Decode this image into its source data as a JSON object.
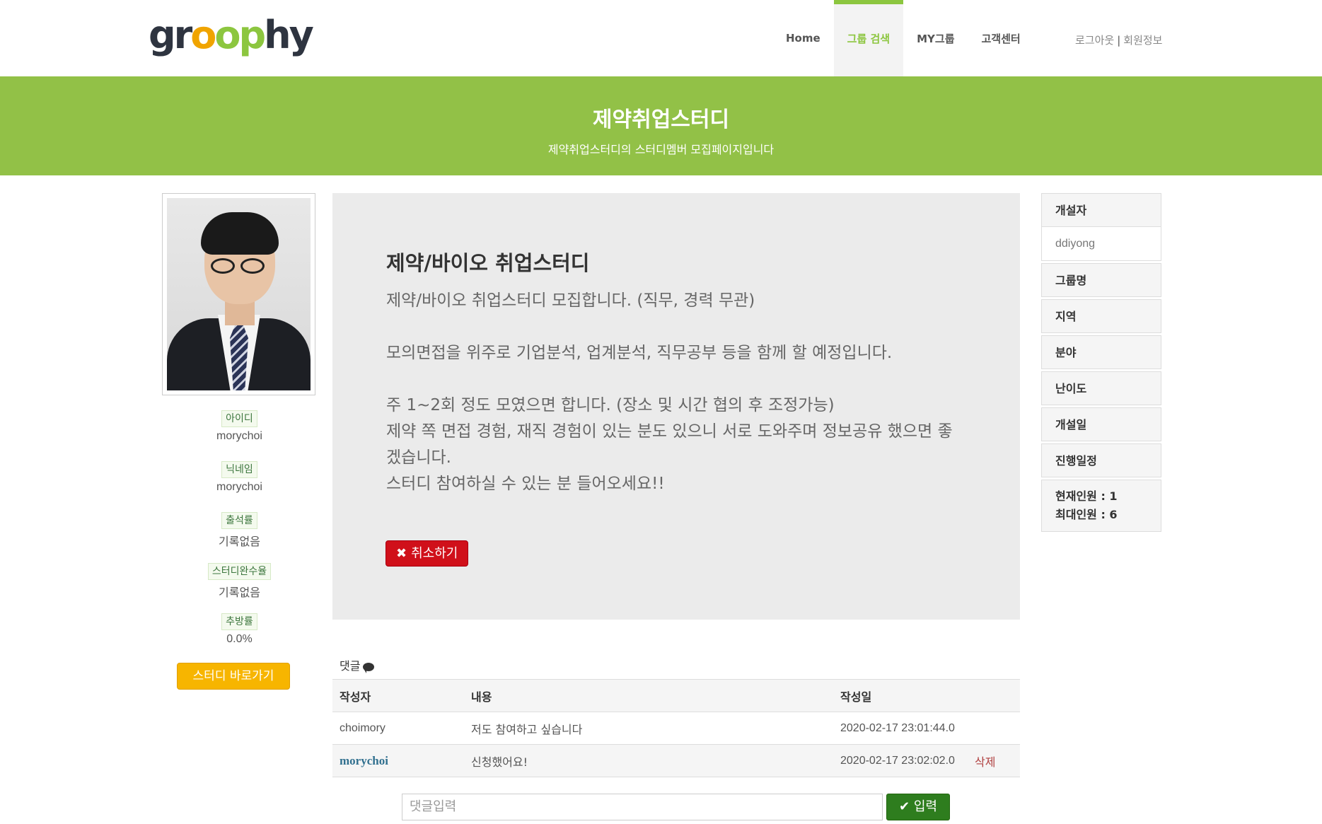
{
  "header": {
    "logo": "groophy",
    "nav": [
      "Home",
      "그룹 검색",
      "MY그룹",
      "고객센터"
    ],
    "active_nav": "그룹 검색",
    "logout": "로그아웃",
    "separator": "|",
    "member_info": "회원정보"
  },
  "banner": {
    "title": "제약취업스터디",
    "subtitle": "제약취업스터디의 스터디멤버 모집페이지입니다"
  },
  "profile": {
    "fields": [
      {
        "label": "아이디",
        "value": "morychoi"
      },
      {
        "label": "닉네임",
        "value": "morychoi"
      },
      {
        "label": "출석률",
        "value": "기록없음"
      },
      {
        "label": "스터디완수율",
        "value": "기록없음"
      },
      {
        "label": "추방률",
        "value": "0.0%"
      }
    ],
    "study_button": "스터디 바로가기"
  },
  "post": {
    "title": "제약/바이오 취업스터디",
    "content": "제약/바이오 취업스터디 모집합니다. (직무, 경력 무관)\n\n모의면접을 위주로 기업분석, 업계분석, 직무공부 등을 함께 할 예정입니다.\n\n주 1~2회 정도 모였으면 합니다. (장소 및 시간 협의 후 조정가능)\n제약 쪽 면접 경험, 재직 경험이 있는 분도 있으니 서로 도와주며 정보공유 했으면 좋겠습니다.\n스터디 참여하실 수 있는 분 들어오세요!!",
    "cancel_button": "취소하기"
  },
  "comments": {
    "title": "댓글",
    "columns": [
      "작성자",
      "내용",
      "작성일"
    ],
    "rows": [
      {
        "author": "choimory",
        "content": "저도 참여하고 싶습니다",
        "date": "2020-02-17 23:01:44.0",
        "action": ""
      },
      {
        "author": "morychoi",
        "content": "신청했어요!",
        "date": "2020-02-17 23:02:02.0",
        "action": "삭제"
      }
    ],
    "input_placeholder": "댓글입력",
    "submit": "입력"
  },
  "sidebar": {
    "creator_label": "개설자",
    "creator_value": "ddiyong",
    "group_name": "그룹명",
    "region": "지역",
    "field": "분야",
    "difficulty": "난이도",
    "created": "개설일",
    "schedule": "진행일정",
    "current_members": "현재인원 : 1",
    "max_members": "최대인원 : 6"
  },
  "colors": {
    "brand_green": "#92c147",
    "nav_active": "#8cc63f",
    "cancel_red": "#d0101a",
    "study_yellow": "#f7b500",
    "submit_green": "#2e7d1e"
  }
}
